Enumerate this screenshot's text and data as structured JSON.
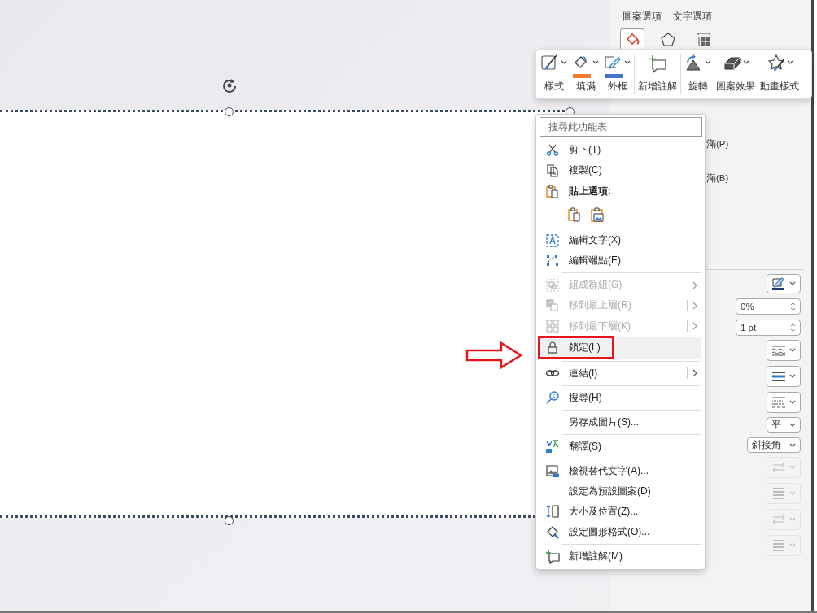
{
  "format_pane": {
    "tabs": [
      {
        "label": "圖案選項"
      },
      {
        "label": "文字選項"
      }
    ],
    "category_icons": [
      {
        "selected": true
      },
      {
        "selected": false
      },
      {
        "selected": false
      }
    ],
    "partial_labels": [
      "滿(P)",
      "滿(B)"
    ],
    "controls": [
      {
        "kind": "color",
        "disabled": false
      },
      {
        "kind": "spin",
        "value": "0%",
        "disabled": false
      },
      {
        "kind": "spin",
        "value": "1 pt",
        "disabled": false
      },
      {
        "kind": "compound",
        "disabled": false
      },
      {
        "kind": "dash",
        "disabled": false
      },
      {
        "kind": "dotted",
        "disabled": false
      },
      {
        "kind": "select",
        "value": "平",
        "disabled": false
      },
      {
        "kind": "select",
        "value": "斜接角",
        "disabled": false
      },
      {
        "kind": "arrows",
        "disabled": true
      },
      {
        "kind": "bars",
        "disabled": true
      },
      {
        "kind": "arrows",
        "disabled": true
      },
      {
        "kind": "bars",
        "disabled": true
      }
    ]
  },
  "mini_toolbar": {
    "groups": [
      [
        {
          "label": "樣式",
          "dropdown": true
        },
        {
          "label": "填滿",
          "dropdown": true,
          "color": "#ed7d31"
        },
        {
          "label": "外框",
          "dropdown": true,
          "color": "#4472c4"
        }
      ],
      [
        {
          "label": "新增註解",
          "dropdown": false
        }
      ],
      [
        {
          "label": "旋轉",
          "dropdown": true
        },
        {
          "label": "圖案效果",
          "dropdown": true
        },
        {
          "label": "動畫樣式",
          "dropdown": true
        }
      ]
    ]
  },
  "context_menu": {
    "search": {
      "placeholder": "搜尋此功能表"
    },
    "items": [
      {
        "kind": "command",
        "label": "剪下(T)",
        "disabled": false,
        "selected": false,
        "submenu": false,
        "split": false
      },
      {
        "kind": "command",
        "label": "複製(C)",
        "disabled": false,
        "selected": false,
        "submenu": false,
        "split": false
      },
      {
        "kind": "header",
        "label": "貼上選項:"
      },
      {
        "kind": "paste_options"
      },
      {
        "kind": "separator"
      },
      {
        "kind": "command",
        "label": "編輯文字(X)",
        "disabled": false,
        "selected": false,
        "submenu": false,
        "split": false
      },
      {
        "kind": "command",
        "label": "編輯端點(E)",
        "disabled": false,
        "selected": false,
        "submenu": false,
        "split": false
      },
      {
        "kind": "separator"
      },
      {
        "kind": "command",
        "label": "組成群組(G)",
        "disabled": true,
        "selected": false,
        "submenu": true,
        "split": false
      },
      {
        "kind": "command",
        "label": "移到最上層(R)",
        "disabled": true,
        "selected": false,
        "submenu": true,
        "split": true
      },
      {
        "kind": "command",
        "label": "移到最下層(K)",
        "disabled": true,
        "selected": false,
        "submenu": true,
        "split": true
      },
      {
        "kind": "command",
        "label": "鎖定(L)",
        "disabled": false,
        "selected": true,
        "submenu": false,
        "split": false,
        "annotated": true
      },
      {
        "kind": "separator"
      },
      {
        "kind": "command",
        "label": "連結(I)",
        "disabled": false,
        "selected": false,
        "submenu": true,
        "split": true
      },
      {
        "kind": "separator"
      },
      {
        "kind": "command",
        "label": "搜尋(H)",
        "disabled": false,
        "selected": false,
        "submenu": false,
        "split": false
      },
      {
        "kind": "separator"
      },
      {
        "kind": "command",
        "label": "另存成圖片(S)...",
        "disabled": false,
        "selected": false,
        "submenu": false,
        "split": false
      },
      {
        "kind": "separator"
      },
      {
        "kind": "command",
        "label": "翻譯(S)",
        "disabled": false,
        "selected": false,
        "submenu": false,
        "split": false
      },
      {
        "kind": "separator"
      },
      {
        "kind": "command",
        "label": "檢視替代文字(A)...",
        "disabled": false,
        "selected": false,
        "submenu": false,
        "split": false
      },
      {
        "kind": "command",
        "label": "設定為預設圖案(D)",
        "disabled": false,
        "selected": false,
        "submenu": false,
        "split": false
      },
      {
        "kind": "command",
        "label": "大小及位置(Z)...",
        "disabled": false,
        "selected": false,
        "submenu": false,
        "split": false
      },
      {
        "kind": "command",
        "label": "設定圖形格式(O)...",
        "disabled": false,
        "selected": false,
        "submenu": false,
        "split": false
      },
      {
        "kind": "separator"
      },
      {
        "kind": "command",
        "label": "新增註解(M)",
        "disabled": false,
        "selected": false,
        "submenu": false,
        "split": false
      }
    ]
  }
}
